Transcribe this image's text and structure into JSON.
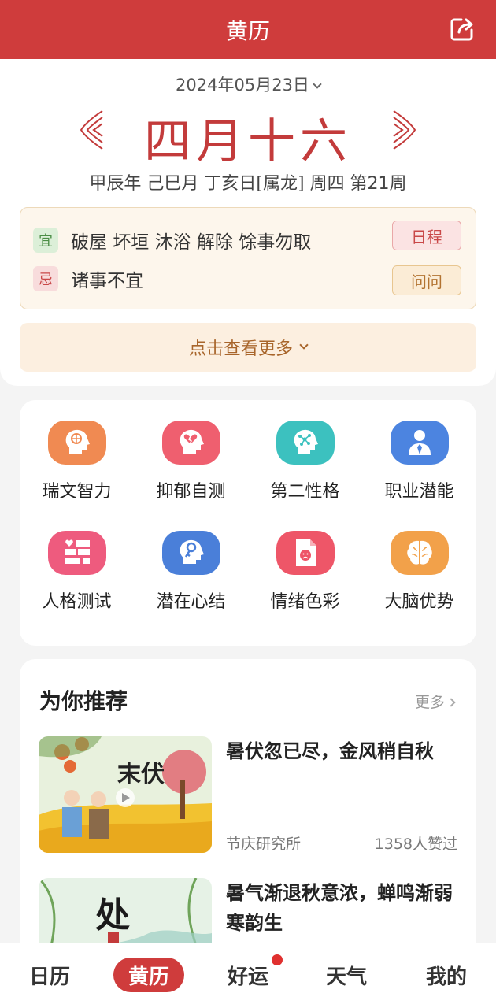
{
  "header": {
    "title": "黄历",
    "edit_icon": "share-edit-icon"
  },
  "almanac": {
    "date": "2024年05月23日",
    "lunar_day": "四月十六",
    "ganzhi": "甲辰年 己巳月 丁亥日[属龙] 周四 第21周",
    "yi_tag": "宜",
    "yi_text": "破屋 坏垣 沐浴 解除 馀事勿取",
    "ji_tag": "忌",
    "ji_text": "诸事不宜",
    "schedule_btn": "日程",
    "ask_btn": "问问",
    "see_more": "点击查看更多"
  },
  "tests": [
    {
      "label": "瑞文智力",
      "icon": "brain-head-icon",
      "color": "#f08a52"
    },
    {
      "label": "抑郁自测",
      "icon": "broken-heart-head-icon",
      "color": "#ef5f6f"
    },
    {
      "label": "第二性格",
      "icon": "molecule-head-icon",
      "color": "#3cc1bf"
    },
    {
      "label": "职业潜能",
      "icon": "businessman-icon",
      "color": "#4c84e0"
    },
    {
      "label": "人格测试",
      "icon": "heart-bricks-icon",
      "color": "#ee5b7e"
    },
    {
      "label": "潜在心结",
      "icon": "key-head-icon",
      "color": "#4a7fd9"
    },
    {
      "label": "情绪色彩",
      "icon": "sad-document-icon",
      "color": "#ee5668"
    },
    {
      "label": "大脑优势",
      "icon": "brain-icon",
      "color": "#f2a14a"
    }
  ],
  "recommend": {
    "title": "为你推荐",
    "more": "更多",
    "articles": [
      {
        "title": "暑伏忽已尽，金风稍自秋",
        "source": "节庆研究所",
        "likes": "1358人赞过",
        "thumb_text": "末伏"
      },
      {
        "title": "暑气渐退秋意浓，蝉鸣渐弱寒韵生",
        "source": "",
        "likes": "",
        "thumb_text": "处"
      }
    ]
  },
  "tabs": [
    {
      "label": "日历",
      "active": false
    },
    {
      "label": "黄历",
      "active": true
    },
    {
      "label": "好运",
      "active": false,
      "badge": true
    },
    {
      "label": "天气",
      "active": false
    },
    {
      "label": "我的",
      "active": false
    }
  ],
  "colors": {
    "brand_red": "#cf3c3c",
    "lunar_red": "#c33b3b"
  }
}
